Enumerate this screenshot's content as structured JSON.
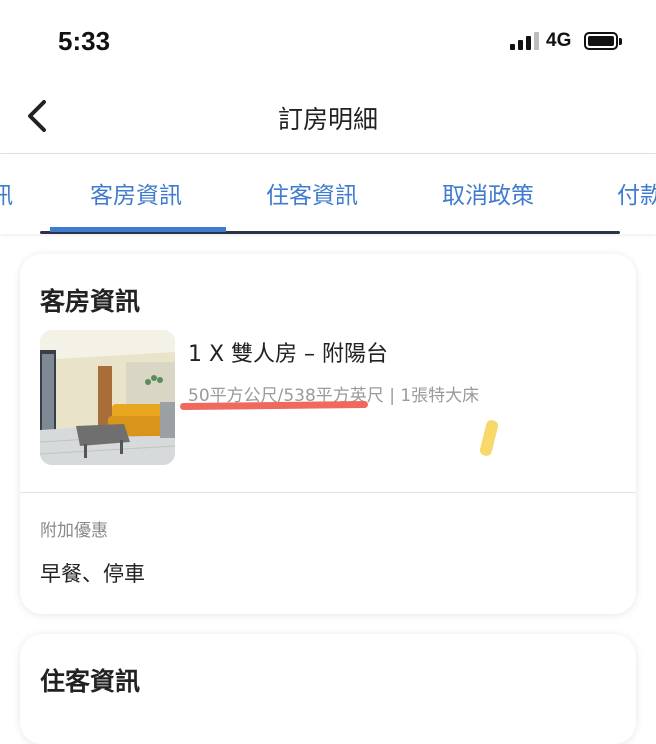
{
  "status_bar": {
    "time": "5:33",
    "network": "4G"
  },
  "header": {
    "title": "訂房明細"
  },
  "tabs": [
    {
      "label": "訊"
    },
    {
      "label": "客房資訊"
    },
    {
      "label": "住客資訊"
    },
    {
      "label": "取消政策"
    },
    {
      "label": "付款"
    }
  ],
  "active_tab": "客房資訊",
  "room_card": {
    "title": "客房資訊",
    "room_name": "1 X 雙人房 – 附陽台",
    "room_spec": "50平方公尺/538平方英尺 | 1張特大床",
    "extra_label": "附加優惠",
    "extra_value": "早餐、停車"
  },
  "guest_card": {
    "title": "住客資訊"
  },
  "colors": {
    "accent": "#3f7ccf",
    "highlight_red": "#ef6a5c",
    "highlight_yellow": "#f6d96a"
  }
}
